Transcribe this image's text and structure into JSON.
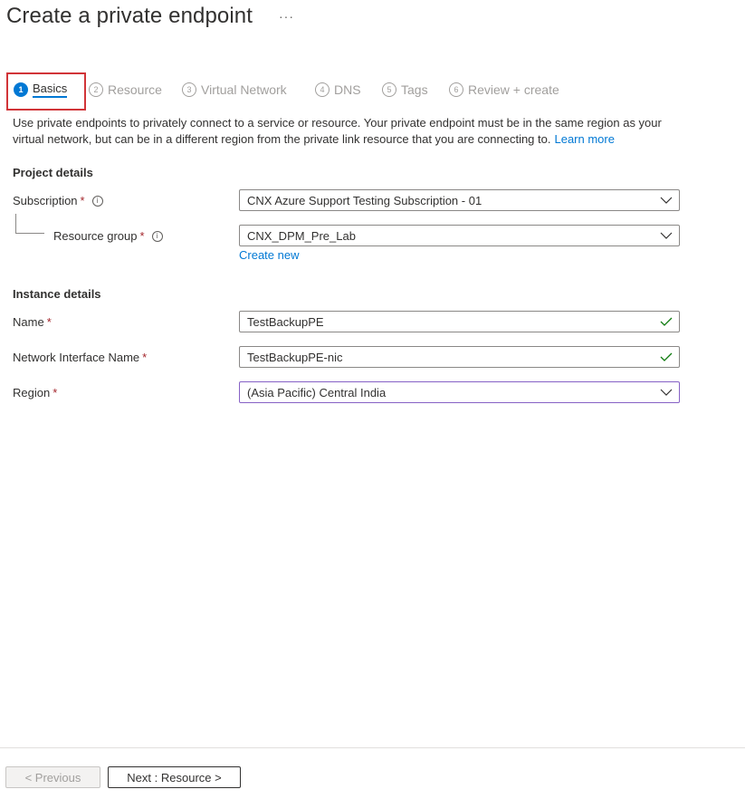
{
  "header": {
    "title": "Create a private endpoint",
    "more": "···"
  },
  "tabs": [
    {
      "num": "1",
      "label": "Basics",
      "active": true
    },
    {
      "num": "2",
      "label": "Resource",
      "active": false
    },
    {
      "num": "3",
      "label": "Virtual Network",
      "active": false
    },
    {
      "num": "4",
      "label": "DNS",
      "active": false
    },
    {
      "num": "5",
      "label": "Tags",
      "active": false
    },
    {
      "num": "6",
      "label": "Review + create",
      "active": false
    }
  ],
  "description": {
    "text": "Use private endpoints to privately connect to a service or resource. Your private endpoint must be in the same region as your virtual network, but can be in a different region from the private link resource that you are connecting to.",
    "link": "Learn more"
  },
  "project": {
    "heading": "Project details",
    "subscription_label": "Subscription",
    "subscription_value": "CNX Azure Support Testing Subscription - 01",
    "resource_group_label": "Resource group",
    "resource_group_value": "CNX_DPM_Pre_Lab",
    "create_new": "Create new"
  },
  "instance": {
    "heading": "Instance details",
    "name_label": "Name",
    "name_value": "TestBackupPE",
    "nic_label": "Network Interface Name",
    "nic_value": "TestBackupPE-nic",
    "region_label": "Region",
    "region_value": "(Asia Pacific) Central India"
  },
  "required_mark": "*",
  "info_glyph": "i",
  "footer": {
    "previous": "< Previous",
    "next": "Next : Resource >"
  },
  "colors": {
    "accent": "#0078d4",
    "required": "#a4262c",
    "valid": "#107c10",
    "highlight": "#d13438"
  }
}
